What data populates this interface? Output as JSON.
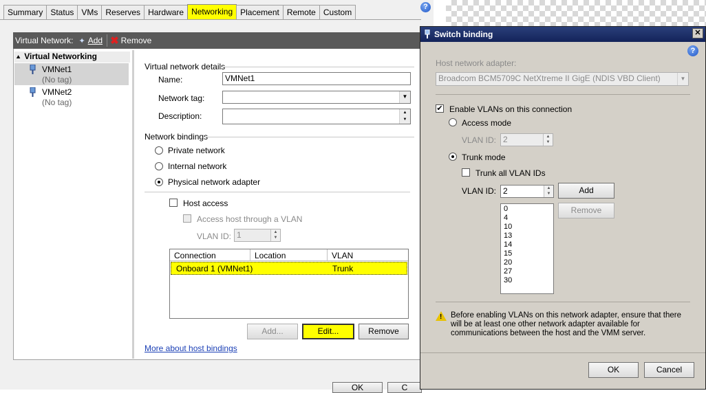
{
  "tabs": [
    "Summary",
    "Status",
    "VMs",
    "Reserves",
    "Hardware",
    "Networking",
    "Placement",
    "Remote",
    "Custom"
  ],
  "active_tab": "Networking",
  "toolbar": {
    "title": "Virtual Network:",
    "add": "Add",
    "remove": "Remove"
  },
  "tree": {
    "header": "Virtual Networking",
    "items": [
      {
        "name": "VMNet1",
        "tag": "(No tag)"
      },
      {
        "name": "VMNet2",
        "tag": "(No tag)"
      }
    ]
  },
  "details": {
    "section": "Virtual network details",
    "name_label": "Name:",
    "name_value": "VMNet1",
    "tag_label": "Network tag:",
    "tag_value": "",
    "desc_label": "Description:",
    "desc_value": ""
  },
  "bindings": {
    "section": "Network bindings",
    "private": "Private network",
    "internal": "Internal network",
    "physical": "Physical network adapter",
    "host_access": "Host access",
    "access_vlan": "Access host through a VLAN",
    "vlan_label": "VLAN ID:",
    "vlan_value": "1"
  },
  "grid": {
    "columns": [
      "Connection",
      "Location",
      "VLAN"
    ],
    "rows": [
      {
        "connection": "Onboard 1 (VMNet1)",
        "location": "",
        "vlan": "Trunk"
      }
    ]
  },
  "buttons": {
    "add": "Add...",
    "edit": "Edit...",
    "remove": "Remove",
    "ok": "OK",
    "cancel": "C"
  },
  "more_link": "More about host bindings",
  "dialog": {
    "title": "Switch binding",
    "adapter_label": "Host network adapter:",
    "adapter_value": "Broadcom BCM5709C NetXtreme II GigE (NDIS VBD Client)",
    "enable_vlans": "Enable VLANs on this connection",
    "access_mode": "Access mode",
    "access_vlan_label": "VLAN ID:",
    "access_vlan_value": "2",
    "trunk_mode": "Trunk mode",
    "trunk_all": "Trunk all VLAN IDs",
    "vlan_label": "VLAN ID:",
    "vlan_value": "2",
    "add": "Add",
    "remove": "Remove",
    "vlan_list": [
      "0",
      "4",
      "10",
      "13",
      "14",
      "15",
      "20",
      "27",
      "30"
    ],
    "warning": "Before enabling VLANs on this network adapter, ensure that there will be at least one other network adapter available for communications between the host and the VMM server.",
    "ok": "OK",
    "cancel": "Cancel"
  }
}
